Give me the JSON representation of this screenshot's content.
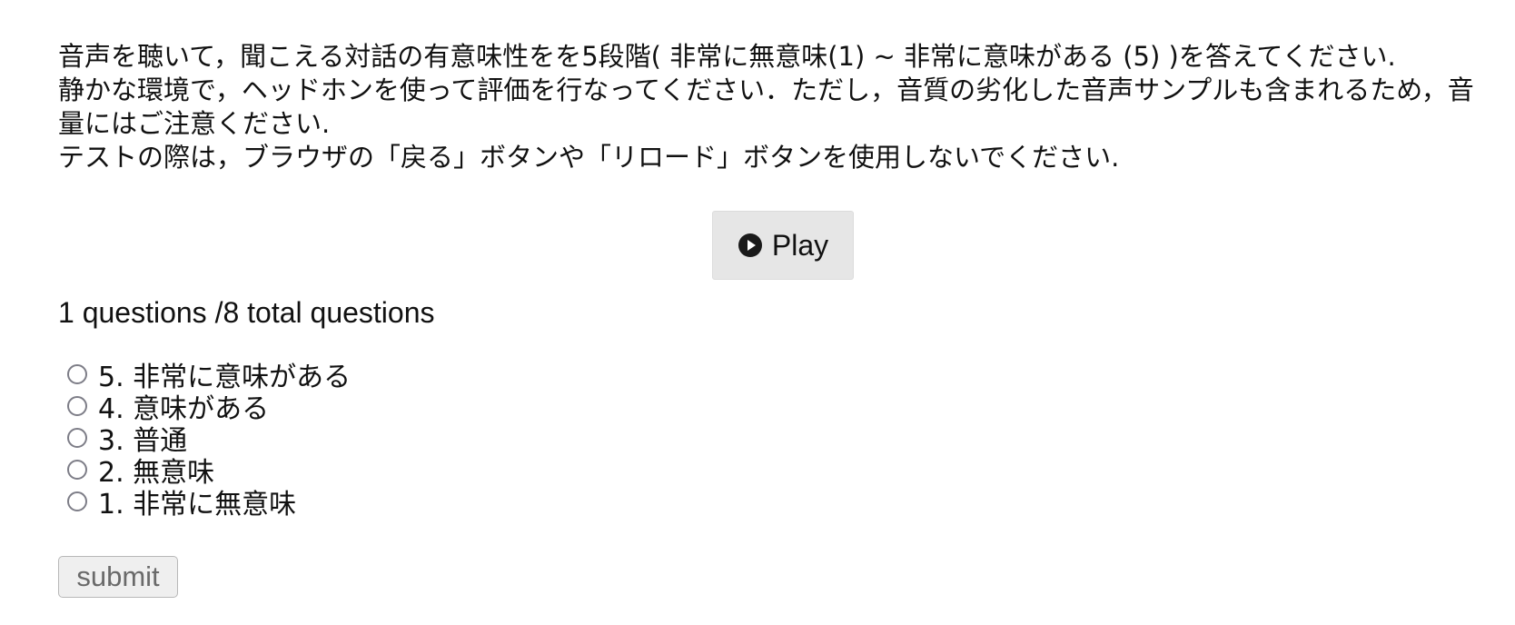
{
  "instructions": {
    "line1": "音声を聴いて，聞こえる対話の有意味性をを5段階( 非常に無意味(1) ~ 非常に意味がある (5) )を答えてください.",
    "line2": "静かな環境で，ヘッドホンを使って評価を行なってください．ただし，音質の劣化した音声サンプルも含まれるため，音量にはご注意ください.",
    "line3": "テストの際は，ブラウザの「戻る」ボタンや「リロード」ボタンを使用しないでください."
  },
  "player": {
    "play_label": "Play",
    "icon": "play-circle-icon"
  },
  "progress": {
    "text": "1 questions /8 total questions"
  },
  "options": [
    {
      "label": "5. 非常に意味がある",
      "selected": false
    },
    {
      "label": "4. 意味がある",
      "selected": false
    },
    {
      "label": "3. 普通",
      "selected": false
    },
    {
      "label": "2. 無意味",
      "selected": false
    },
    {
      "label": "1. 非常に無意味",
      "selected": false
    }
  ],
  "form": {
    "submit_label": "submit"
  }
}
